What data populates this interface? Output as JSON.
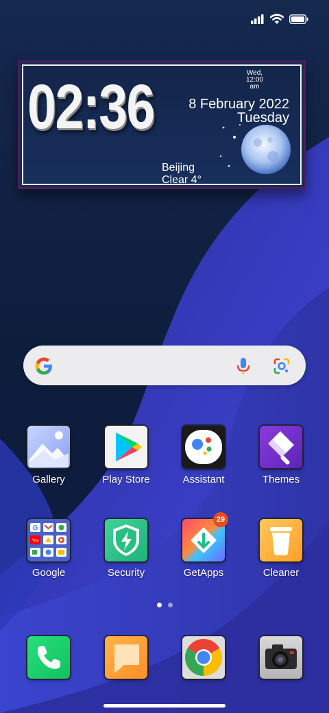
{
  "status_bar": {
    "icons": [
      "signal-icon",
      "wifi-icon",
      "battery-icon"
    ]
  },
  "clock_widget": {
    "time": "02:36",
    "small_line1": "Wed,",
    "small_line2": "12:00",
    "small_line3": "am",
    "date": "8 February 2022",
    "day": "Tuesday",
    "city": "Beijing",
    "weather": "Clear 4°"
  },
  "search": {
    "icons": [
      "google-g-icon",
      "mic-icon",
      "lens-icon"
    ],
    "background": "#ececee"
  },
  "apps": [
    {
      "label": "Gallery",
      "icon": "gallery-icon"
    },
    {
      "label": "Play Store",
      "icon": "play-store-icon"
    },
    {
      "label": "Assistant",
      "icon": "assistant-icon"
    },
    {
      "label": "Themes",
      "icon": "themes-icon"
    },
    {
      "label": "Google",
      "icon": "google-folder-icon"
    },
    {
      "label": "Security",
      "icon": "security-icon"
    },
    {
      "label": "GetApps",
      "icon": "getapps-icon",
      "badge": "29"
    },
    {
      "label": "Cleaner",
      "icon": "cleaner-icon"
    }
  ],
  "dock": [
    {
      "icon": "phone-icon"
    },
    {
      "icon": "messages-icon"
    },
    {
      "icon": "chrome-icon"
    },
    {
      "icon": "camera-icon"
    }
  ],
  "page_indicator": {
    "pages": 2,
    "current": 1
  },
  "colors": {
    "wallpaper_dark": "#0f1f3f",
    "wallpaper_accent": "#3a3fd0",
    "badge": "#ea4a1c"
  }
}
